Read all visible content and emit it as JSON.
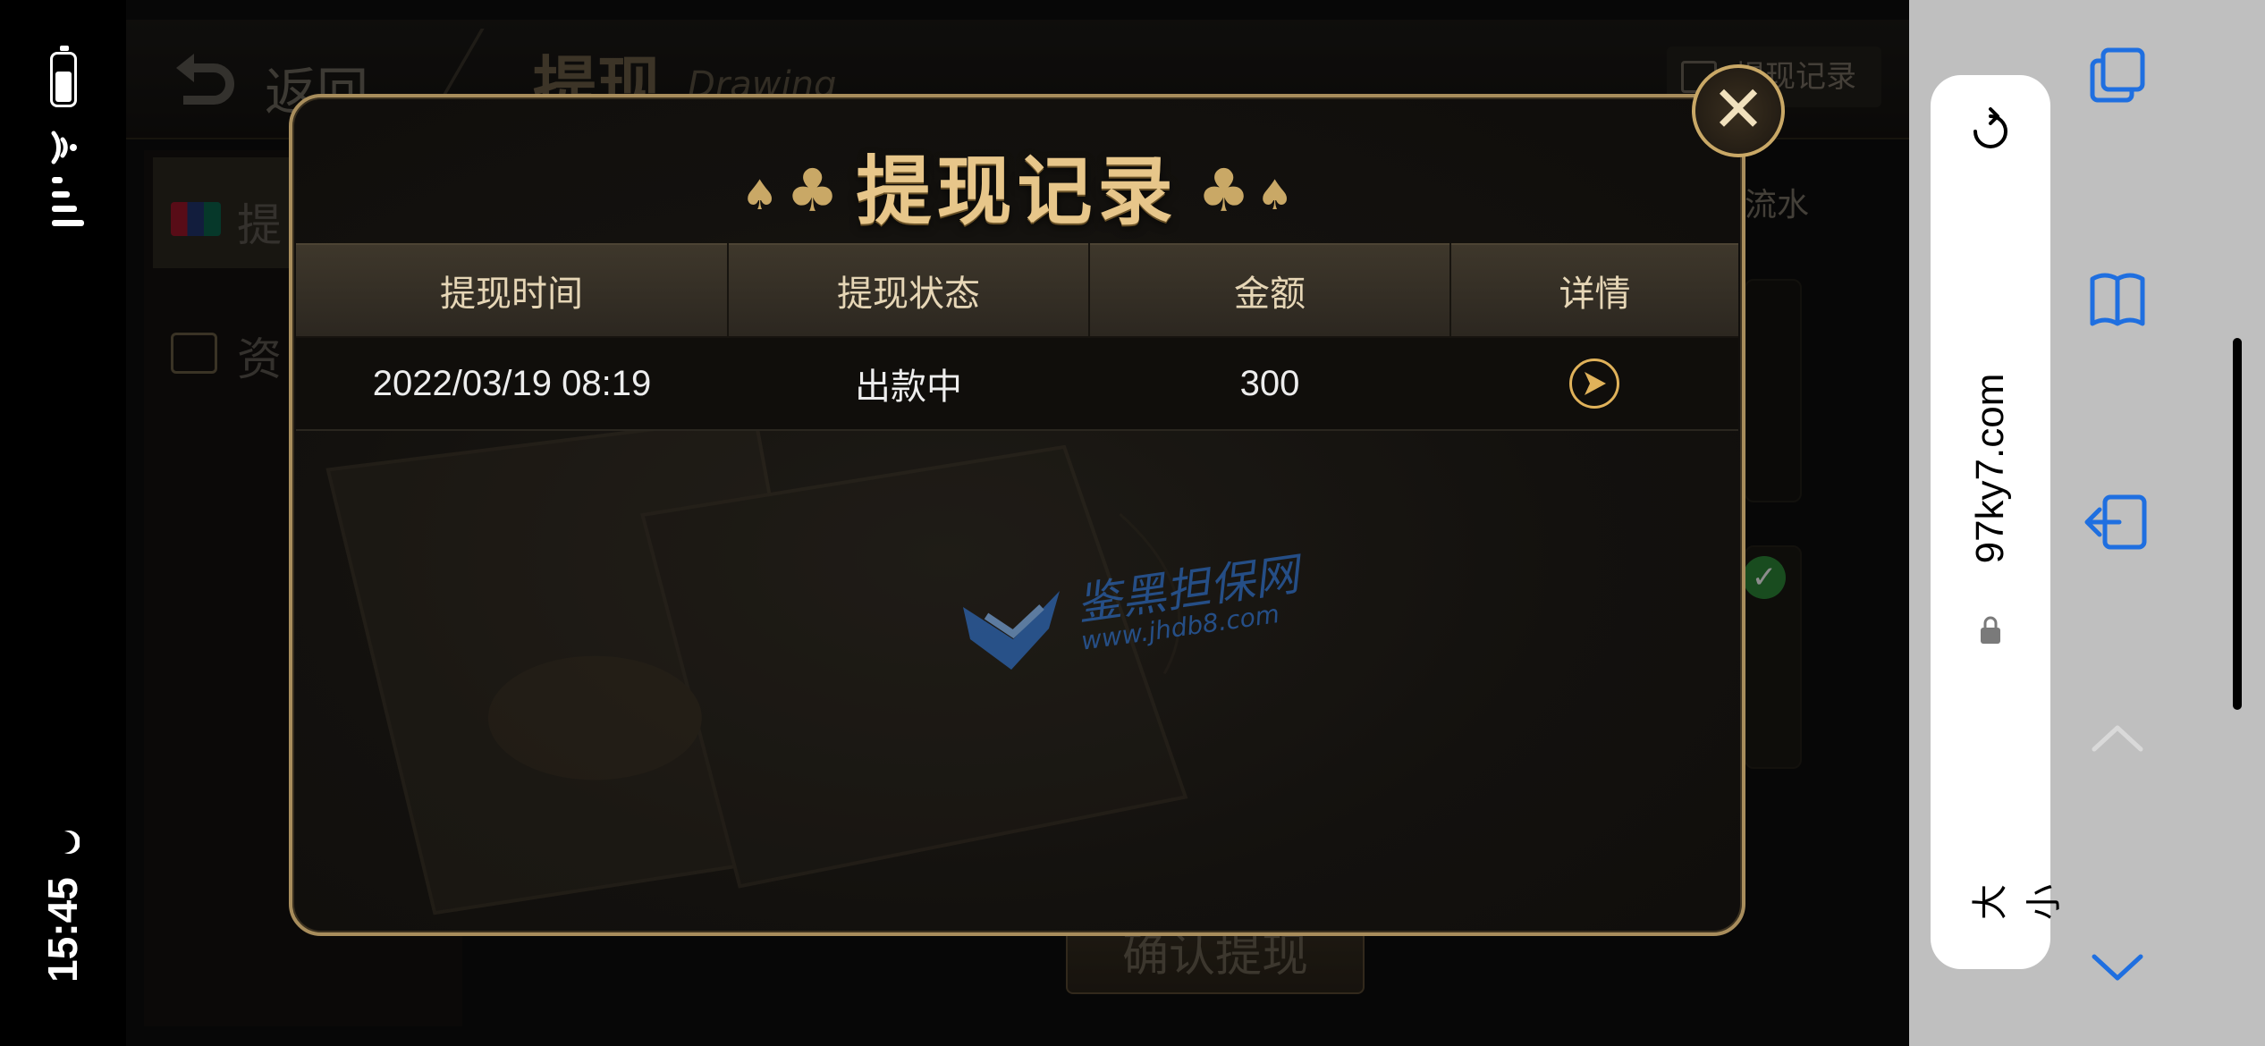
{
  "status": {
    "time": "15:45",
    "icons": [
      "battery-icon",
      "wifi-icon",
      "cellular-signal-icon",
      "moon-icon"
    ]
  },
  "game": {
    "back_label": "返回",
    "title": "提现",
    "title_en": "Drawing",
    "records_button": "提现记录",
    "tabs": [
      {
        "label": "提",
        "icon": "unionpay-icon"
      },
      {
        "label": "资",
        "icon": "fund-icon"
      }
    ],
    "flow_label": "流水",
    "confirm_button": "确认提现"
  },
  "modal": {
    "title": "提现记录",
    "columns": [
      "提现时间",
      "提现状态",
      "金额",
      "详情"
    ],
    "rows": [
      {
        "time": "2022/03/19 08:19",
        "status": "出款中",
        "amount": "300"
      }
    ],
    "close_icon": "close-icon",
    "colors": {
      "border": "#a88d5c",
      "title": "#e7c68a",
      "detail_icon": "#e0b25a"
    }
  },
  "watermark": {
    "name": "鉴黑担保网",
    "url": "www.jhdb8.com"
  },
  "browser": {
    "url": "97ky7.com",
    "text_size_label": "大小",
    "icons": [
      "reload-icon",
      "lock-icon",
      "tabs-icon",
      "bookmarks-icon",
      "exit-icon",
      "chevron-up-icon",
      "chevron-down-icon"
    ]
  }
}
